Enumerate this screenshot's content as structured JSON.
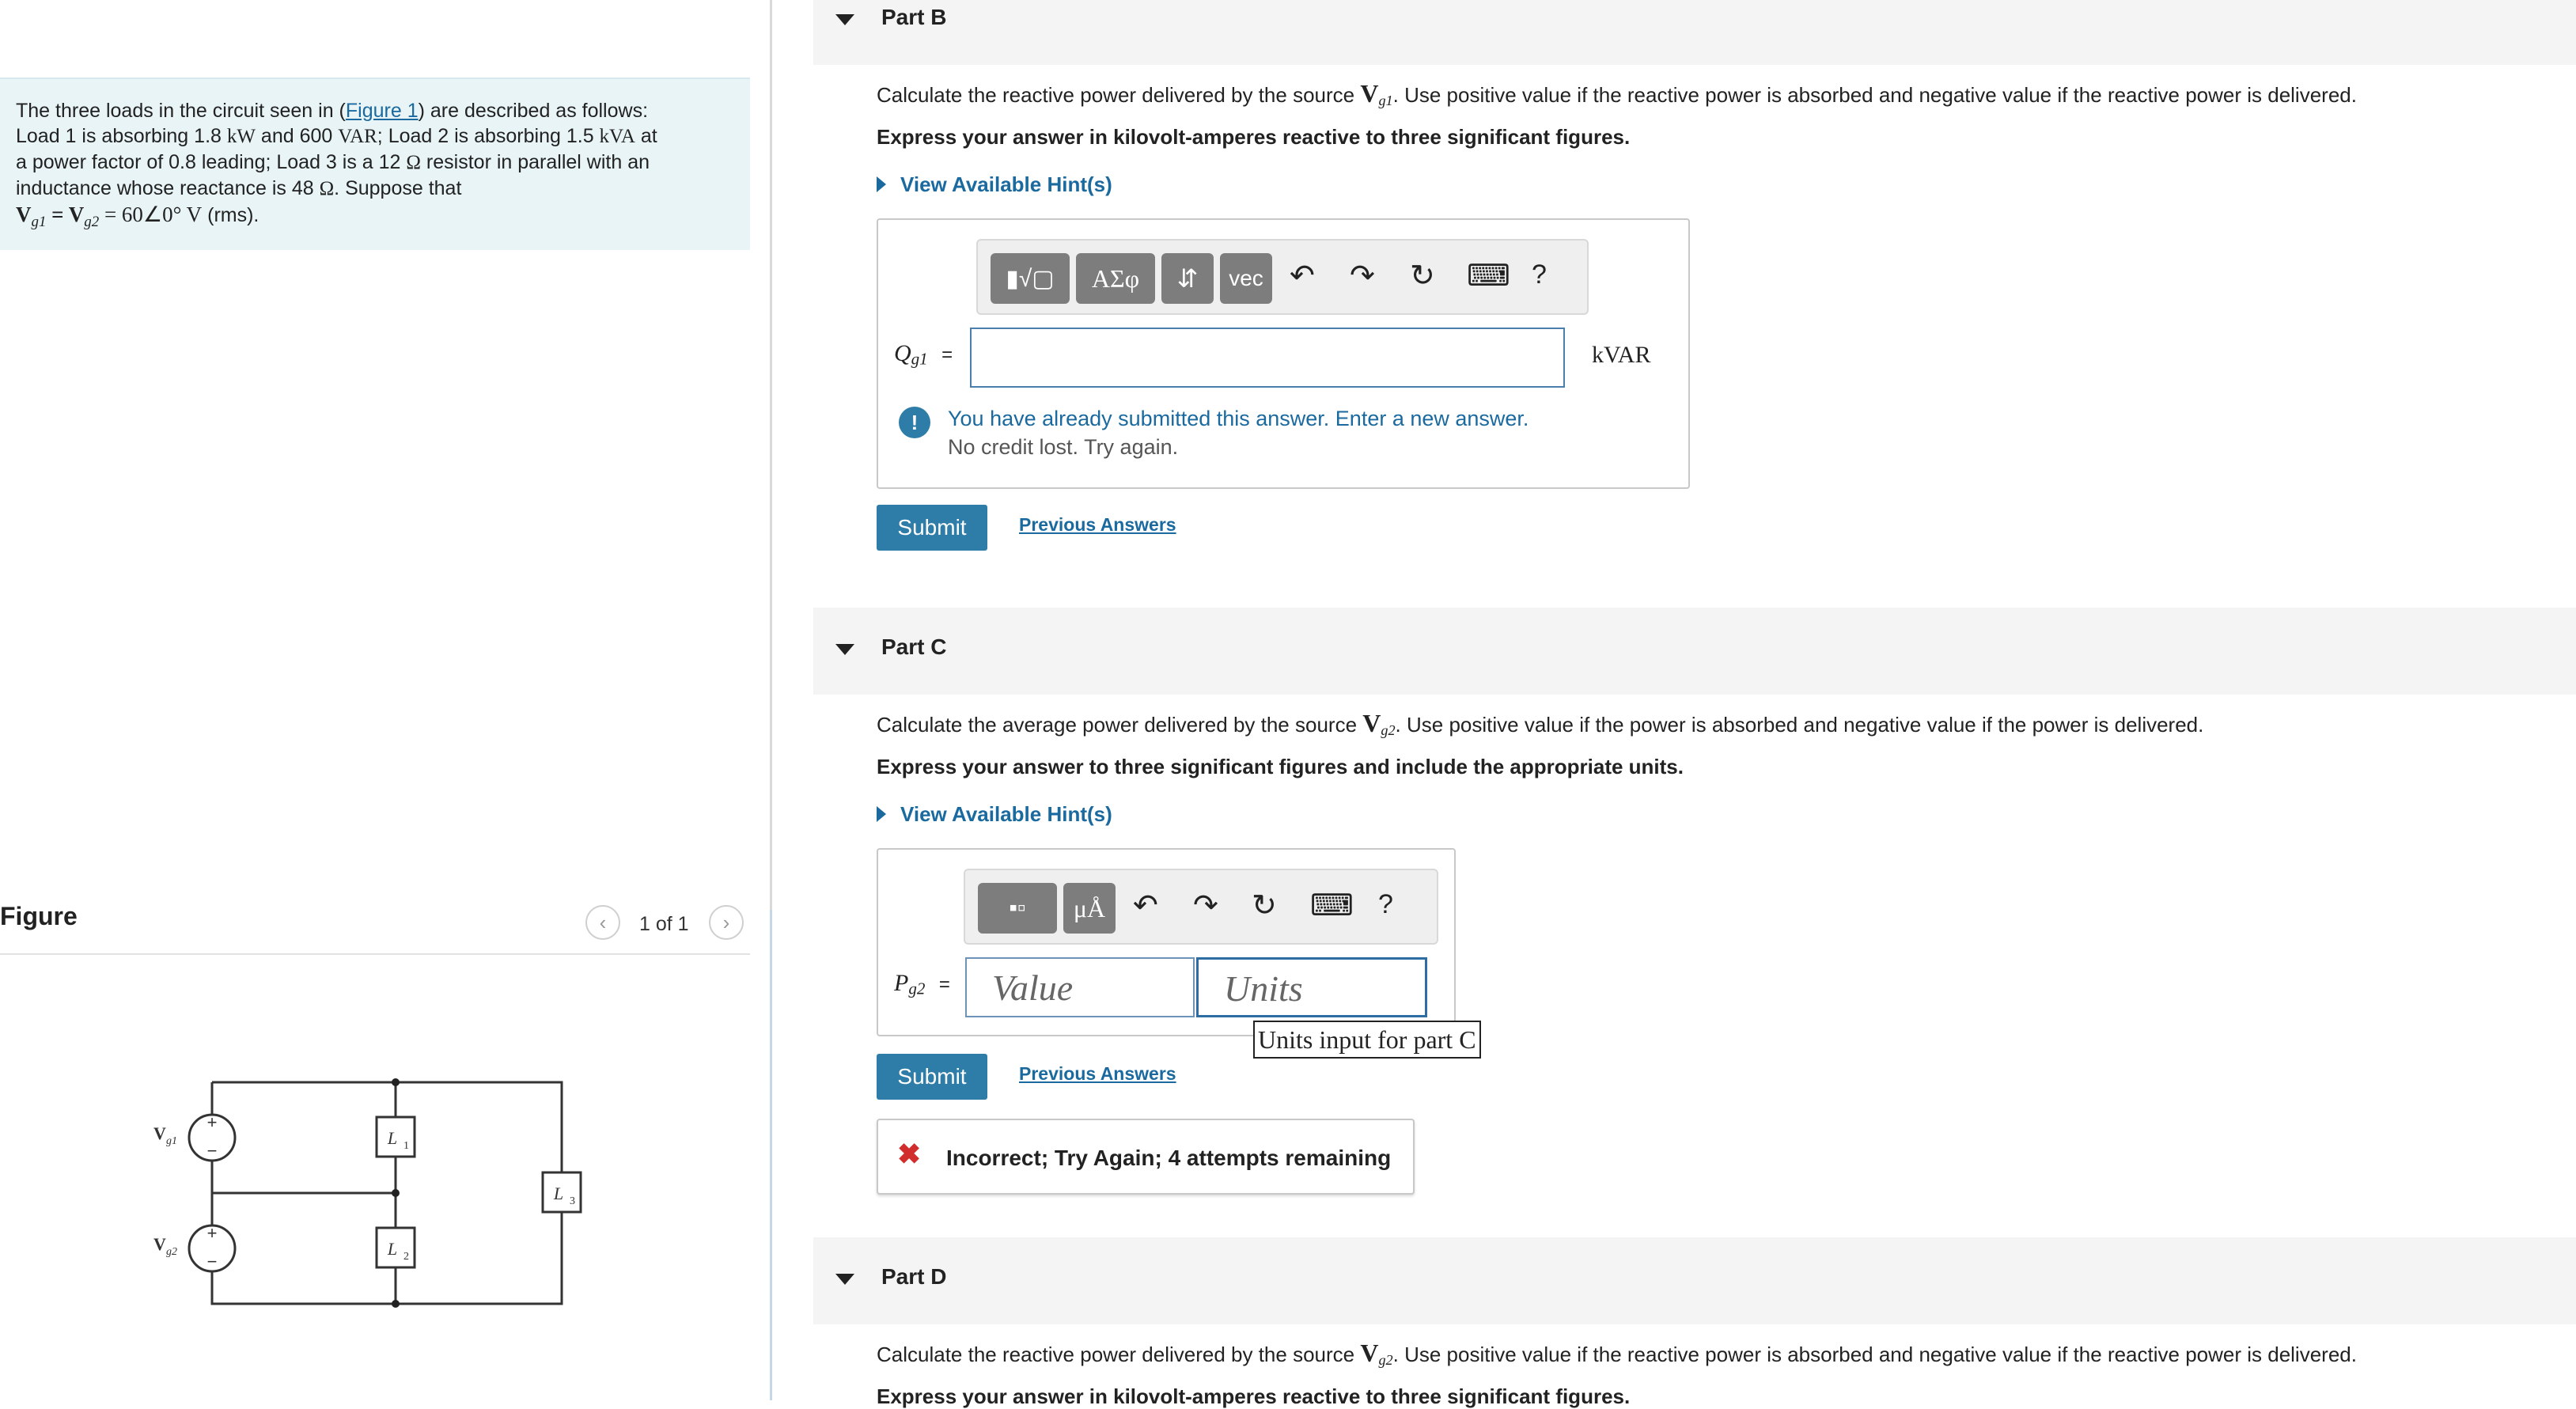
{
  "problem": {
    "intro_pre": "The three loads in the circuit seen in (",
    "figure_link": "Figure 1",
    "intro_post": ") are described as follows:",
    "line2_a": "Load 1 is absorbing 1.8 ",
    "line2_kw": "kW",
    "line2_b": " and 600 ",
    "line2_var": "VAR",
    "line2_c": "; Load 2 is absorbing 1.5 ",
    "line2_kva": "kVA",
    "line2_d": " at",
    "line3_a": "a power factor of 0.8 leading; Load 3 is a 12 ",
    "line3_ohm": "Ω",
    "line3_b": " resistor in parallel with an",
    "line4_a": "inductance whose reactance is 48 ",
    "line4_ohm": "Ω",
    "line4_b": ". Suppose that",
    "line5": "V",
    "line5_g1": "g1",
    "line5_eq": " = V",
    "line5_g2": "g2",
    "line5_val": " = 60∠0° V",
    "line5_rms": " (rms)."
  },
  "figure": {
    "title": "Figure",
    "count": "1 of 1",
    "prev_glyph": "‹",
    "next_glyph": "›",
    "labels": {
      "vg1": "V",
      "vg1_sub": "g1",
      "vg2": "V",
      "vg2_sub": "g2",
      "l1": "L",
      "l1_sub": "1",
      "l2": "L",
      "l2_sub": "2",
      "l3": "L",
      "l3_sub": "3",
      "plus": "+",
      "minus": "−"
    }
  },
  "partB": {
    "title": "Part B",
    "question_pre": "Calculate the reactive power delivered by the source ",
    "question_var": "V",
    "question_sub": "g1",
    "question_post": ". Use positive value if the reactive power is absorbed and negative value if the reactive power is delivered.",
    "instruction": "Express your answer in kilovolt-amperes reactive to three significant figures.",
    "hint": "View Available Hint(s)",
    "toolbar": {
      "btn_matrix": "▮√▢",
      "btn_greek": "ΑΣφ",
      "btn_updown": "⇵",
      "btn_vec": "vec",
      "undo": "↶",
      "redo": "↷",
      "reset": "↻",
      "keyboard": "⌨",
      "help": "?"
    },
    "input_label": "Q",
    "input_label_sub": "g1",
    "input_eq": "=",
    "input_value": "",
    "unit": "kVAR",
    "feedback_main": "You have already submitted this answer. Enter a new answer.",
    "feedback_sub": "No credit lost. Try again.",
    "feedback_icon": "!",
    "submit": "Submit",
    "previous": "Previous Answers"
  },
  "partC": {
    "title": "Part C",
    "question_pre": "Calculate the average power delivered by the source ",
    "question_var": "V",
    "question_sub": "g2",
    "question_post": ". Use positive value if the power is absorbed and negative value if the power is delivered.",
    "instruction": "Express your answer to three significant figures and include the appropriate units.",
    "hint": "View Available Hint(s)",
    "toolbar": {
      "btn_templates": "▪▫",
      "btn_units": "μÅ",
      "undo": "↶",
      "redo": "↷",
      "reset": "↻",
      "keyboard": "⌨",
      "help": "?"
    },
    "input_label": "P",
    "input_label_sub": "g2",
    "input_eq": "=",
    "value_placeholder": "Value",
    "units_placeholder": "Units",
    "units_tooltip": "Units input for part C",
    "submit": "Submit",
    "previous": "Previous Answers",
    "feedback_icon": "✖",
    "feedback": "Incorrect; Try Again; 4 attempts remaining"
  },
  "partD": {
    "title": "Part D",
    "question_pre": "Calculate the reactive power delivered by the source ",
    "question_var": "V",
    "question_sub": "g2",
    "question_post": ". Use positive value if the reactive power is absorbed and negative value if the reactive power is delivered.",
    "instruction": "Express your answer in kilovolt-amperes reactive to three significant figures."
  }
}
